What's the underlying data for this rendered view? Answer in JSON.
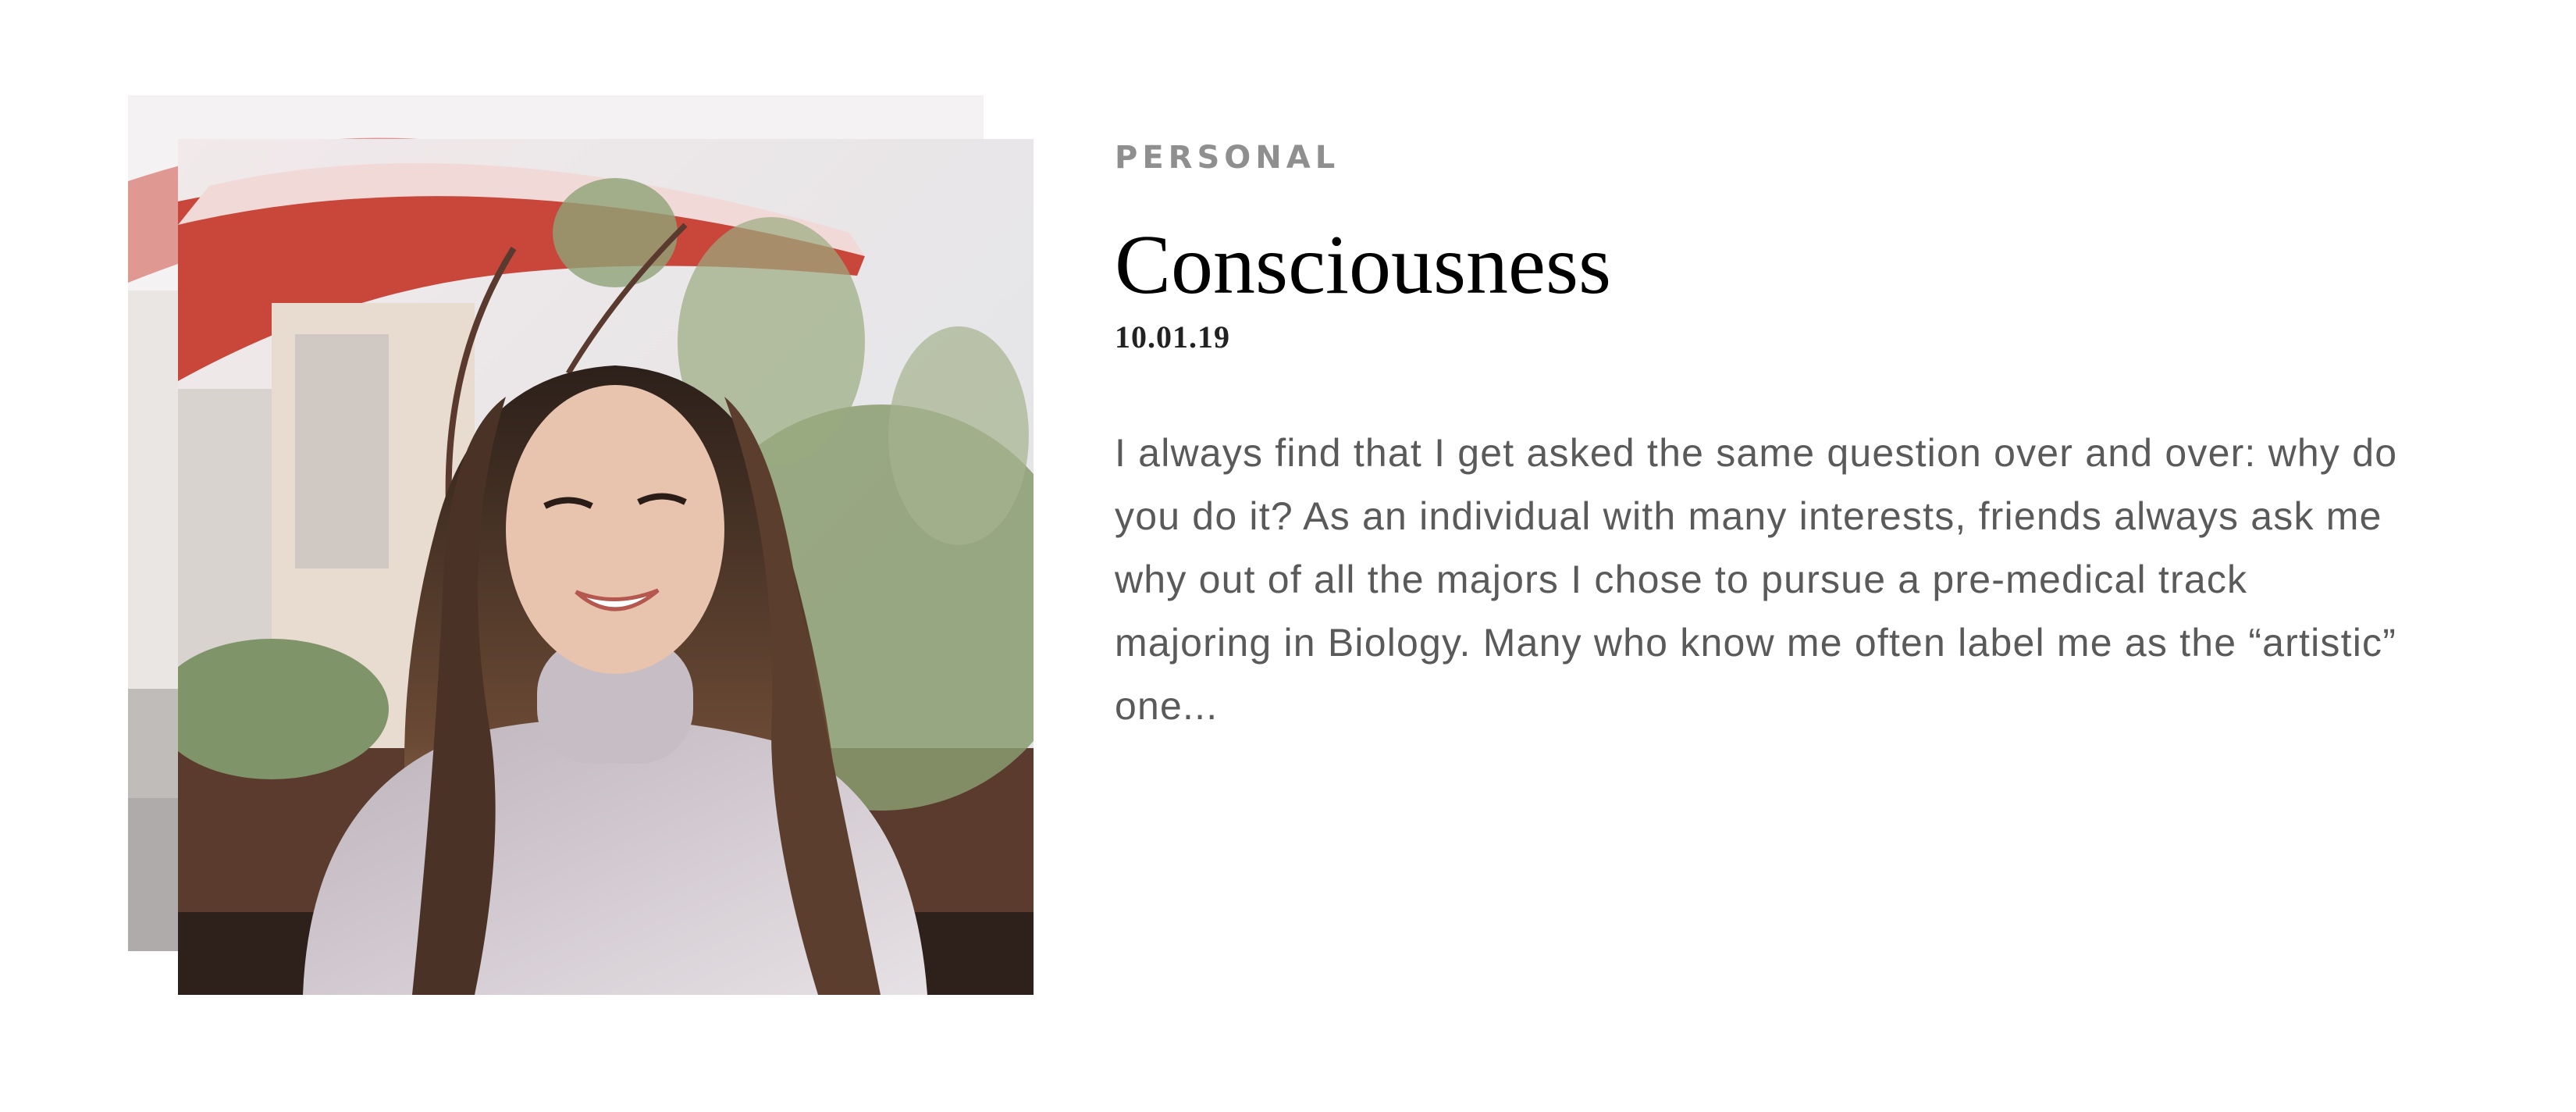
{
  "post": {
    "category": "PERSONAL",
    "title": "Consciousness",
    "date": "10.01.19",
    "excerpt": "I always find that I get asked the same question over and over: why do you do it? As an individual with many interests, friends always ask me why out of all the majors I chose to pursue a pre-medical track majoring in Biology. Many who know me often label me as the “artistic” one..."
  },
  "photo": {
    "subject": "portrait-photo",
    "palette": {
      "umbrella": "#c8463a",
      "sky": "#ece8ea",
      "foliage": "#7f9468",
      "planter": "#5a3b2e",
      "hair": "#3a2a22",
      "sweater": "#cfc6cc",
      "skin": "#e8c3ad"
    }
  }
}
